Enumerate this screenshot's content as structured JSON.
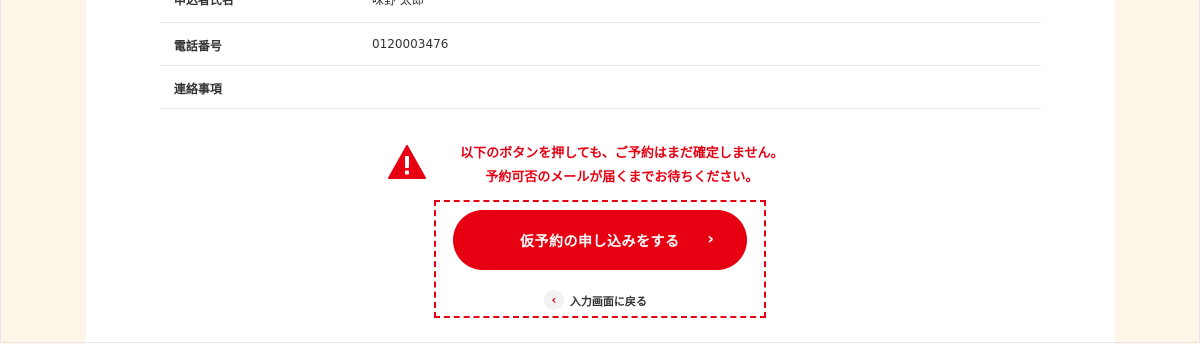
{
  "table": {
    "rows": [
      {
        "label": "申込者氏名",
        "value": "味野 太郎"
      },
      {
        "label": "電話番号",
        "value": "0120003476"
      },
      {
        "label": "連絡事項",
        "value": ""
      }
    ]
  },
  "warning": {
    "icon": "warning-icon",
    "line1": "以下のボタンを押しても、ご予約はまだ確定しません。",
    "line2": "予約可否のメールが届くまでお待ちください。",
    "color": "#e60012"
  },
  "actions": {
    "submit_label": "仮予約の申し込みをする",
    "submit_arrow": "›",
    "back_label": "入力画面に戻る",
    "back_arrow": "‹"
  },
  "colors": {
    "accent": "#e60012",
    "page_background": "#fef5e9",
    "panel_background": "#ffffff"
  }
}
